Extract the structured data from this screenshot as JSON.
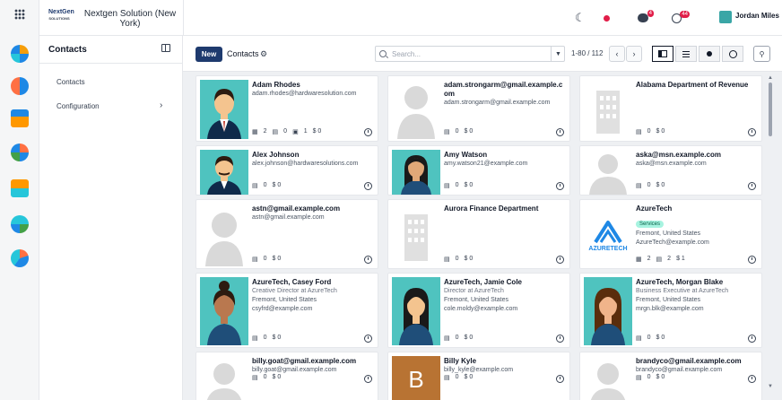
{
  "brand": {
    "logo_text": "NextGen SOLUTIONS"
  },
  "topbar": {
    "company": "Nextgen Solution (New York)",
    "messages_count": "4",
    "activity_count": "44",
    "username": "Jordan Miles"
  },
  "sidebar": {
    "title": "Contacts",
    "items": [
      {
        "label": "Contacts"
      },
      {
        "label": "Configuration"
      }
    ]
  },
  "controls": {
    "new_label": "New",
    "breadcrumb": "Contacts",
    "search_placeholder": "Search...",
    "pager": "1-80 / 112"
  },
  "colors": {
    "primary": "#1e3a6e",
    "teal": "#4fc3bf",
    "letter_avatar": "#b87333",
    "tag_bg": "#a7f3e0"
  },
  "cards": [
    {
      "name": "Adam Rhodes",
      "lines": [
        "adam.rhodes@hardwaresolution.com"
      ],
      "stats": [
        "2",
        "0",
        "1",
        "$ 0"
      ]
    },
    {
      "name": "adam.strongarm@gmail.example.com",
      "lines": [
        "adam.strongarm@gmail.example.com"
      ],
      "stats": [
        "0",
        "$ 0"
      ]
    },
    {
      "name": "Alabama Department of Revenue",
      "lines": [],
      "stats": [
        "0",
        "$ 0"
      ]
    },
    {
      "name": "Alex Johnson",
      "lines": [
        "alex.johnson@hardwaresolutions.com"
      ],
      "stats": [
        "0",
        "$ 0"
      ]
    },
    {
      "name": "Amy Watson",
      "lines": [
        "amy.watson21@example.com"
      ],
      "stats": [
        "0",
        "$ 0"
      ]
    },
    {
      "name": "aska@msn.example.com",
      "lines": [
        "aska@msn.example.com"
      ],
      "stats": [
        "0",
        "$ 0"
      ]
    },
    {
      "name": "astn@gmail.example.com",
      "lines": [
        "astn@gmail.example.com"
      ],
      "stats": [
        "0",
        "$ 0"
      ]
    },
    {
      "name": "Aurora Finance Department",
      "lines": [],
      "stats": [
        "0",
        "$ 0"
      ]
    },
    {
      "name": "AzureTech",
      "tag": "Services",
      "lines": [
        "Fremont, United States",
        "AzureTech@example.com"
      ],
      "stats": [
        "2",
        "2",
        "$ 1"
      ]
    },
    {
      "name": "AzureTech, Casey Ford",
      "lines": [
        "Creative Director at AzureTech",
        "Fremont, United States",
        "csyfrd@example.com"
      ],
      "stats": [
        "0",
        "$ 0"
      ]
    },
    {
      "name": "AzureTech, Jamie Cole",
      "lines": [
        "Director at AzureTech",
        "Fremont, United States",
        "cole.moldy@example.com"
      ],
      "stats": [
        "0",
        "$ 0"
      ]
    },
    {
      "name": "AzureTech, Morgan Blake",
      "lines": [
        "Business Executive at AzureTech",
        "Fremont, United States",
        "mrgn.blk@example.com"
      ],
      "stats": [
        "0",
        "$ 0"
      ]
    },
    {
      "name": "billy.goat@gmail.example.com",
      "lines": [
        "billy.goat@gmail.example.com"
      ],
      "stats": [
        "0",
        "$ 0"
      ]
    },
    {
      "name": "Billy Kyle",
      "lines": [
        "billy_kyle@example.com"
      ],
      "stats": [
        "0",
        "$ 0"
      ]
    },
    {
      "name": "brandyco@gmail.example.com",
      "lines": [
        "brandyco@gmail.example.com"
      ],
      "stats": [
        "0",
        "$ 0"
      ]
    }
  ],
  "logos": {
    "azuretech_text": "AZURETECH",
    "letter_avatar": "B"
  }
}
